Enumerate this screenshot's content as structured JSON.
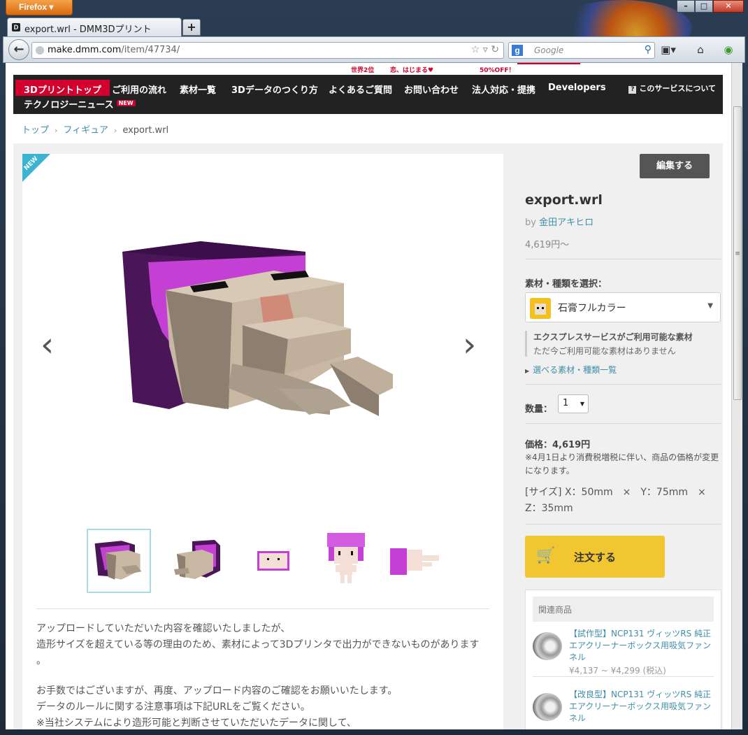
{
  "browser": {
    "app_button": "Firefox",
    "tab_title": "export.wrl - DMM3Dプリント",
    "url_host": "make.dmm.com",
    "url_path": "/item/47734/",
    "search_engine": "Google",
    "search_placeholder": "Google"
  },
  "promo": {
    "item1": "世界2位",
    "item2": "恋、はじまる♥",
    "item3": "50%OFF！"
  },
  "site_nav": {
    "items": [
      "3Dプリントトップ",
      "ご利用の流れ",
      "素材一覧",
      "3Dデータのつくり方",
      "よくあるご質問",
      "お問い合わせ",
      "法人対応・提携",
      "Developers"
    ],
    "about": "このサービスについて",
    "news": "テクノロジーニュース",
    "news_badge": "NEW"
  },
  "breadcrumb": {
    "top": "トップ",
    "category": "フィギュア",
    "current": "export.wrl"
  },
  "viewer": {
    "ribbon": "NEW"
  },
  "description": {
    "p1_l1": "アップロードしていただいた内容を確認いたしましたが、",
    "p1_l2": "造形サイズを超えている等の理由のため、素材によって3Dプリンタで出力ができないものがあります",
    "p1_l3": "。",
    "p2_l1": "お手数ではございますが、再度、アップロード内容のご確認をお願いいたします。",
    "p2_l2": "データのルールに関する注意事項は下記URLをご覧ください。",
    "p2_l3": "※当社システムにより造形可能と判断させていただいたデータに関して、"
  },
  "product": {
    "edit_label": "編集する",
    "title": "export.wrl",
    "by_prefix": "by",
    "author": "金田アキヒロ",
    "price_from": "4,619円〜",
    "material_label": "素材・種類を選択：",
    "material_selected": "石膏フルカラー",
    "express_title": "エクスプレスサービスがご利用可能な素材",
    "express_note": "ただ今ご利用可能な素材はありません",
    "material_list_link": "選べる素材・種類一覧",
    "qty_label": "数量：",
    "qty_value": "1",
    "price_label": "価格：4,619円",
    "price_note": "※4月1日より消費税増税に伴い、商品の価格が変更になります。",
    "size_line1": "[サイズ] X：50mm　×　Y：75mm　×",
    "size_line2": "Z：35mm",
    "order_label": "注文する"
  },
  "related": {
    "heading": "関連商品",
    "items": [
      {
        "name": "【試作型】NCP131 ヴィッツRS 純正エアクリーナーボックス用吸気ファンネル",
        "price": "¥4,137 ~ ¥4,299 (税込)"
      },
      {
        "name": "【改良型】NCP131 ヴィッツRS 純正エアクリーナーボックス用吸気ファンネル",
        "price": ""
      }
    ]
  },
  "colors": {
    "accent_red": "#d3002d",
    "link_blue": "#3f8ea8",
    "order_yellow": "#f1c631",
    "nav_black": "#222222"
  }
}
